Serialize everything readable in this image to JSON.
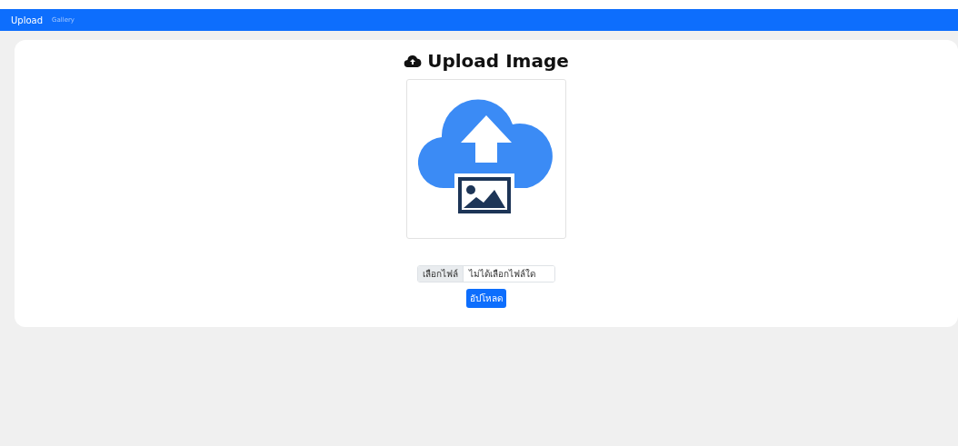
{
  "navbar": {
    "links": [
      {
        "label": "Upload",
        "selected": true
      },
      {
        "label": "Gallery",
        "selected": false
      }
    ]
  },
  "card": {
    "title": "Upload Image",
    "file_input": {
      "button": "เลือกไฟล์",
      "placeholder": "ไม่ได้เลือกไฟล์ใด"
    },
    "submit": "อัปโหลด"
  }
}
